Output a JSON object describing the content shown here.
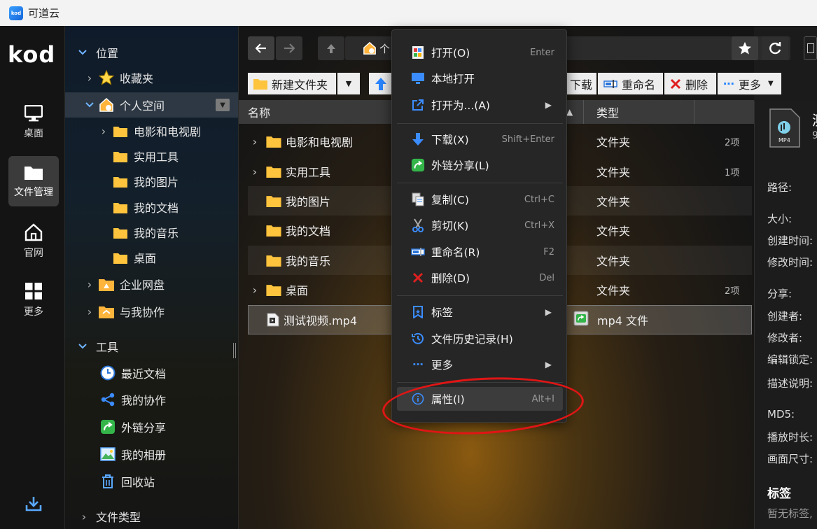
{
  "app": {
    "logo": "kod",
    "title": "可道云"
  },
  "rail": {
    "brand": "kod",
    "items": [
      {
        "label": "桌面",
        "icon": "monitor-icon"
      },
      {
        "label": "文件管理",
        "icon": "folder-icon"
      },
      {
        "label": "官网",
        "icon": "home-icon"
      },
      {
        "label": "更多",
        "icon": "grid-icon"
      }
    ],
    "bottom_icon": "download-icon"
  },
  "tree": {
    "location": "位置",
    "favorites": "收藏夹",
    "personal": "个人空间",
    "children": [
      "电影和电视剧",
      "实用工具",
      "我的图片",
      "我的文档",
      "我的音乐",
      "桌面"
    ],
    "enterprise": "企业网盘",
    "collab": "与我协作",
    "tools": "工具",
    "tool_items": [
      "最近文档",
      "我的协作",
      "外链分享",
      "我的相册",
      "回收站"
    ],
    "file_types": "文件类型"
  },
  "path": {
    "current": "个"
  },
  "toolbar": {
    "new_folder": "新建文件夹",
    "download": "下载",
    "rename": "重命名",
    "delete": "删除",
    "more": "更多"
  },
  "list": {
    "col_name": "名称",
    "col_type": "类型",
    "rows": [
      {
        "name": "电影和电视剧",
        "type": "文件夹",
        "size": "2项"
      },
      {
        "name": "实用工具",
        "type": "文件夹",
        "size": "1项"
      },
      {
        "name": "我的图片",
        "type": "文件夹",
        "size": ""
      },
      {
        "name": "我的文档",
        "type": "文件夹",
        "size": ""
      },
      {
        "name": "我的音乐",
        "type": "文件夹",
        "size": ""
      },
      {
        "name": "桌面",
        "type": "文件夹",
        "size": "2项"
      },
      {
        "name": "测试视频.mp4",
        "type": "mp4 文件",
        "size": ""
      }
    ]
  },
  "context_menu": {
    "open": "打开(O)",
    "open_key": "Enter",
    "open_local": "本地打开",
    "open_with": "打开为...(A)",
    "download": "下载(X)",
    "download_key": "Shift+Enter",
    "share": "外链分享(L)",
    "copy": "复制(C)",
    "copy_key": "Ctrl+C",
    "cut": "剪切(K)",
    "cut_key": "Ctrl+X",
    "rename": "重命名(R)",
    "rename_key": "F2",
    "delete": "删除(D)",
    "delete_key": "Del",
    "tags": "标签",
    "history": "文件历史记录(H)",
    "more": "更多",
    "properties": "属性(I)",
    "properties_key": "Alt+I"
  },
  "detail": {
    "title_partial": "测",
    "sub_partial": "9",
    "file_badge": "MP4",
    "path": "路径:",
    "size": "大小:",
    "created": "创建时间:",
    "modified": "修改时间:",
    "share": "分享:",
    "creator": "创建者:",
    "modifier": "修改者:",
    "lock": "编辑锁定:",
    "desc": "描述说明:",
    "md5": "MD5:",
    "duration": "播放时长:",
    "dimension": "画面尺寸:",
    "tags_title": "标签",
    "no_tags": "暂无标签,"
  }
}
